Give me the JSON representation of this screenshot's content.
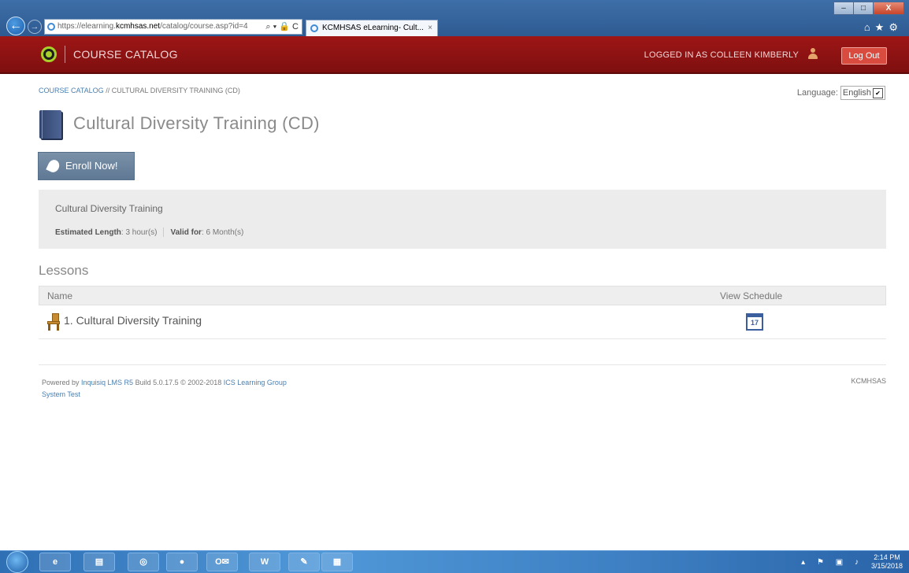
{
  "browser": {
    "url_prefix": "https://elearning.",
    "url_domain": "kcmhsas.net",
    "url_path": "/catalog/course.asp?id=4",
    "addr_tools": "⌕ ▾ 🔒 C",
    "tab_title": "KCMHSAS eLearning- Cult...",
    "tab_close": "×",
    "back": "←",
    "forward": "→",
    "win_minimize": "–",
    "win_maximize": "□",
    "win_close": "X",
    "fav_icons": "⌂★⚙"
  },
  "header": {
    "title": "COURSE CATALOG",
    "logged_in": "LOGGED IN AS COLLEEN KIMBERLY",
    "logout_label": "Log Out",
    "brand_color": "#8b1212"
  },
  "breadcrumb": {
    "link": "COURSE CATALOG",
    "separator": " // ",
    "current": "CULTURAL DIVERSITY TRAINING (CD)"
  },
  "language": {
    "label": "Language:",
    "selected": "English",
    "arrow": "✔"
  },
  "course": {
    "title": "Cultural Diversity Training (CD)",
    "enroll_label": "Enroll Now!",
    "description": "Cultural Diversity Training",
    "length_label": "Estimated Length",
    "length_value": ": 3 hour(s)",
    "valid_label": "Valid for",
    "valid_value": ": 6 Month(s)"
  },
  "lessons": {
    "heading": "Lessons",
    "col_name": "Name",
    "col_schedule": "View Schedule",
    "rows": [
      {
        "name": "1. Cultural Diversity Training",
        "calendar_day": "17"
      }
    ]
  },
  "footer": {
    "powered_by": "Powered by ",
    "product_link": "Inquisiq LMS R5",
    "build": " Build 5.0.17.5 © 2002-2018 ",
    "company_link": "ICS Learning Group",
    "system_test": "System Test",
    "org": "KCMHSAS"
  },
  "taskbar": {
    "items": [
      "e",
      "▤",
      "◎",
      "●",
      "O✉",
      "W",
      "✎",
      "▦"
    ],
    "tray_icons": "▴ ⚑ ▣ ♪",
    "time": "2:14 PM",
    "date": "3/15/2018"
  }
}
